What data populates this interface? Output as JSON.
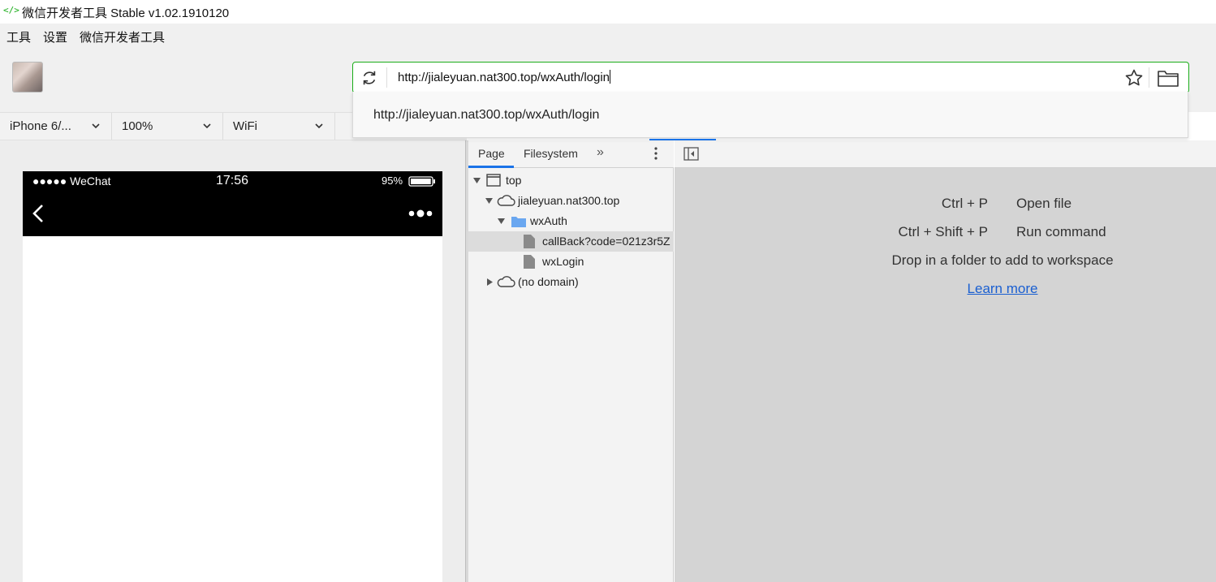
{
  "window": {
    "title": "微信开发者工具 Stable v1.02.1910120",
    "title_icon": "</>"
  },
  "menu": [
    "工具",
    "设置",
    "微信开发者工具"
  ],
  "address_bar": {
    "url": "http://jialeyuan.nat300.top/wxAuth/login",
    "suggestion": "http://jialeyuan.nat300.top/wxAuth/login"
  },
  "device_bar": {
    "device": "iPhone 6/...",
    "zoom": "100%",
    "network": "WiFi"
  },
  "simulator": {
    "carrier": "●●●●● WeChat",
    "time": "17:56",
    "battery": "95%",
    "battery_level": 0.95
  },
  "devtools": {
    "tabs": [
      "Page",
      "Filesystem"
    ],
    "more_tabs": "»",
    "tree": {
      "top": "top",
      "domain": "jialeyuan.nat300.top",
      "folder": "wxAuth",
      "file1": "callBack?code=021z3r5Z",
      "file2": "wxLogin",
      "no_domain": "(no domain)"
    },
    "shortcuts": [
      {
        "key": "Ctrl + P",
        "action": "Open file"
      },
      {
        "key": "Ctrl + Shift + P",
        "action": "Run command"
      }
    ],
    "drop_hint": "Drop in a folder to add to workspace",
    "learn_more": "Learn more"
  },
  "colors": {
    "accent_green": "#1aad19",
    "devtools_blue": "#1a73e8",
    "link_blue": "#1a5fd1"
  }
}
